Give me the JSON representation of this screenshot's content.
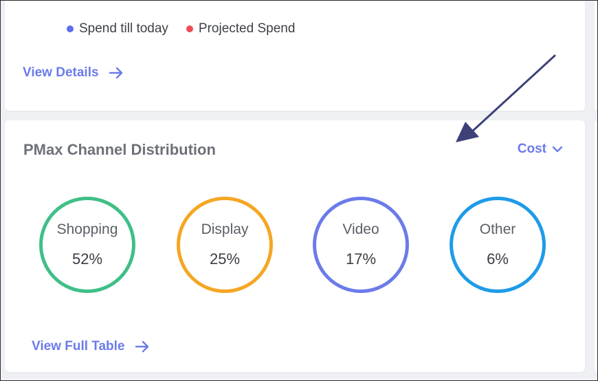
{
  "top_card": {
    "legend": [
      {
        "label": "Spend till today",
        "color": "#5b6ff0"
      },
      {
        "label": "Projected Spend",
        "color": "#ef4b57"
      }
    ],
    "view_details_label": "View Details"
  },
  "channel_card": {
    "title": "PMax Channel Distribution",
    "metric_selected": "Cost",
    "channels": [
      {
        "name": "Shopping",
        "percent": "52%",
        "color": "#3fbf87"
      },
      {
        "name": "Display",
        "percent": "25%",
        "color": "#f5a623"
      },
      {
        "name": "Video",
        "percent": "17%",
        "color": "#6b7bea"
      },
      {
        "name": "Other",
        "percent": "6%",
        "color": "#1e9be8"
      }
    ],
    "view_full_table_label": "View Full Table"
  },
  "colors": {
    "accent": "#6b7bea",
    "annotation_arrow": "#3d4178"
  }
}
